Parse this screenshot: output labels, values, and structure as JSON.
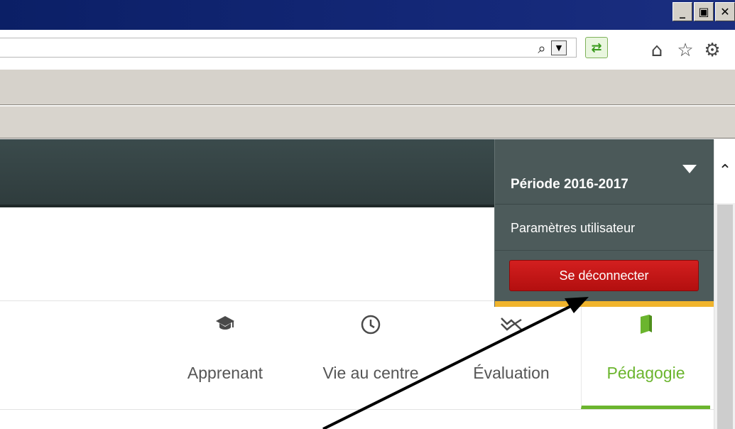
{
  "window": {
    "controls": {
      "minimize_icon": "minimize-icon",
      "restore_icon": "restore-icon",
      "close_icon": "close-icon",
      "minimize": "_",
      "restore": "▣",
      "close": "✕"
    }
  },
  "toolbar": {
    "search_glyph": "⌕",
    "dropdown_glyph": "▼",
    "compat_glyph": "⇄",
    "home_glyph": "⌂",
    "favorites_glyph": "☆",
    "settings_glyph": "⚙"
  },
  "user_menu": {
    "period_label": "Période 2016-2017",
    "settings_label": "Paramètres utilisateur",
    "logout_label": "Se déconnecter",
    "accent_color": "#f0b42c",
    "logout_color": "#c41515"
  },
  "scrollbar": {
    "up_glyph": "⌃"
  },
  "nav": {
    "active_color": "#6bb52e",
    "tabs": [
      {
        "label": "Apprenant",
        "icon_name": "graduation-cap-icon",
        "glyph": "☕"
      },
      {
        "label": "Vie au centre",
        "icon_name": "clock-icon",
        "glyph": "◷"
      },
      {
        "label": "Évaluation",
        "icon_name": "chart-trend-icon",
        "glyph": "≈"
      },
      {
        "label": "Pédagogie",
        "icon_name": "book-icon",
        "glyph": "▮",
        "active": true
      }
    ]
  }
}
